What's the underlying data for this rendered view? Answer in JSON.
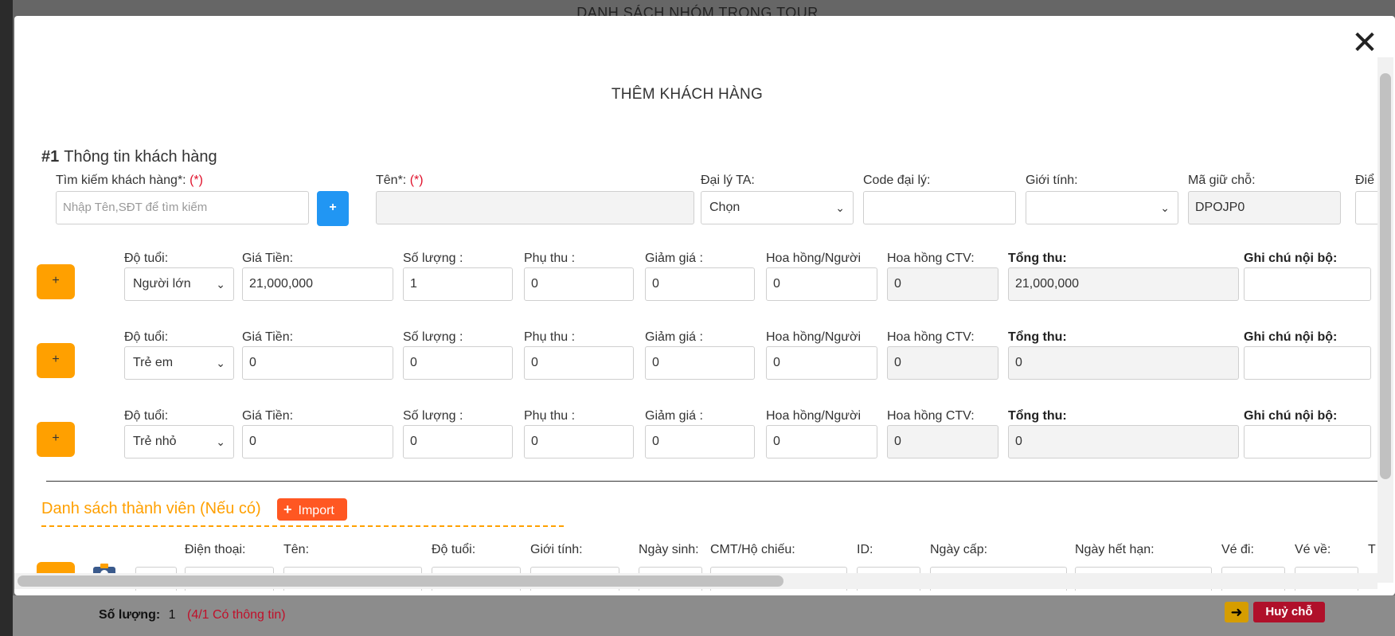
{
  "background": {
    "title": "DANH SÁCH NHÓM TRONG TOUR",
    "footer": {
      "quantity_label": "Số lượng:",
      "quantity_value": "1",
      "quantity_info": "(4/1 Có thông tin)",
      "cancel_label": "Huỷ chỗ",
      "arrow_icon": "arrow-right-icon"
    }
  },
  "modal": {
    "title": "THÊM KHÁCH HÀNG",
    "close_glyph": "✕",
    "section1": {
      "number": "#1",
      "title": "Thông tin khách hàng"
    },
    "customer_fields": {
      "search_label": "Tìm kiếm khách hàng*:",
      "required_mark": "(*)",
      "search_placeholder": "Nhập Tên,SĐT để tìm kiếm",
      "add_glyph": "+",
      "name_label": "Tên*:",
      "agency_label": "Đại lý TA:",
      "agency_value": "Chọn",
      "agency_code_label": "Code đại lý:",
      "gender_label": "Giới tính:",
      "hold_code_label": "Mã giữ chỗ:",
      "hold_code_value": "DPOJP0",
      "points_label": "Điể"
    },
    "price_headers": {
      "age": "Độ tuổi:",
      "price": "Giá Tiền:",
      "quantity": "Số lượng :",
      "surcharge": "Phụ thu :",
      "discount": "Giảm giá :",
      "commission_person": "Hoa hồng/Người",
      "commission_ctv": "Hoa hồng CTV:",
      "total": "Tổng thu:",
      "internal_note": "Ghi chú nội bộ:"
    },
    "price_rows": [
      {
        "age": "Người lớn",
        "price": "21,000,000",
        "quantity": "1",
        "surcharge": "0",
        "discount": "0",
        "commission_person": "0",
        "commission_ctv": "0",
        "total": "21,000,000"
      },
      {
        "age": "Trẻ em",
        "price": "0",
        "quantity": "0",
        "surcharge": "0",
        "discount": "0",
        "commission_person": "0",
        "commission_ctv": "0",
        "total": "0"
      },
      {
        "age": "Trẻ nhỏ",
        "price": "0",
        "quantity": "0",
        "surcharge": "0",
        "discount": "0",
        "commission_person": "0",
        "commission_ctv": "0",
        "total": "0"
      }
    ],
    "row_add_glyph": "+",
    "members": {
      "title": "Danh sách thành viên (Nếu có)",
      "import_label": "Import",
      "import_glyph": "+",
      "headers": {
        "phone": "Điện thoại:",
        "name": "Tên:",
        "age": "Độ tuổi:",
        "gender": "Giới tính:",
        "dob": "Ngày sinh:",
        "passport": "CMT/Hộ chiếu:",
        "id": "ID:",
        "issue_date": "Ngày cấp:",
        "expiry_date": "Ngày hết hạn:",
        "ticket_out": "Vé đi:",
        "ticket_back": "Vé về:",
        "extra": "T"
      }
    }
  }
}
